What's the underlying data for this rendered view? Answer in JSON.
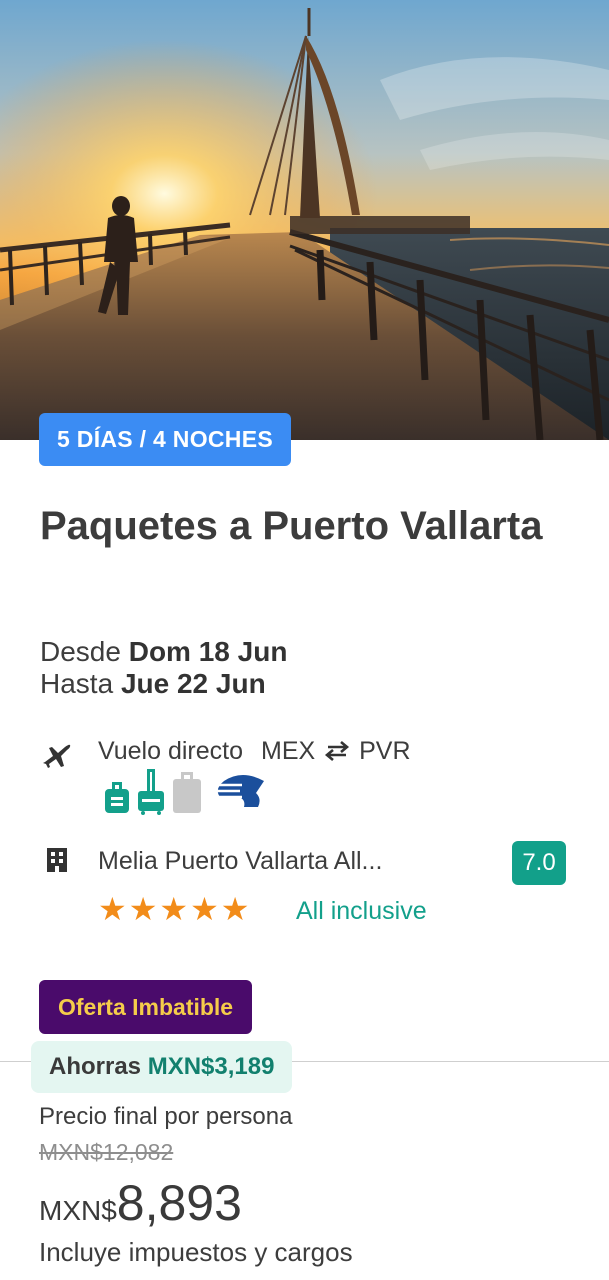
{
  "hero": {
    "image": "sunset-pier-puerto-vallarta"
  },
  "badge": {
    "days_nights": "5 DÍAS / 4 NOCHES"
  },
  "package": {
    "title": "Paquetes a Puerto Vallarta",
    "from_label": "Desde",
    "from_date": "Dom 18 Jun",
    "to_label": "Hasta",
    "to_date": "Jue 22 Jun"
  },
  "flight": {
    "icon": "plane-icon",
    "type": "Vuelo directo",
    "origin": "MEX",
    "destination": "PVR",
    "swap_icon": "swap-arrows-icon",
    "baggage": [
      {
        "icon": "personal-bag-icon",
        "included": true
      },
      {
        "icon": "carry-on-icon",
        "included": true
      },
      {
        "icon": "checked-bag-icon",
        "included": false
      }
    ],
    "airline_logo": "airline-logo",
    "colors": {
      "included": "#13a08b",
      "not_included": "#c8c8c8",
      "airline": "#1b4f9c"
    }
  },
  "hotel": {
    "icon": "building-icon",
    "name": "Melia Puerto Vallarta All...",
    "rating": "7.0",
    "stars": "★★★★★",
    "stars_count": 5,
    "meal_plan": "All inclusive"
  },
  "offer": {
    "label": "Oferta Imbatible"
  },
  "savings": {
    "label": "Ahorras",
    "amount": "MXN$3,189"
  },
  "price": {
    "label": "Precio final por persona",
    "old_price": "MXN$12,082",
    "currency": "MXN$",
    "amount": "8,893",
    "note": "Incluye impuestos y cargos"
  },
  "colors": {
    "badge_blue": "#3b8cf3",
    "offer_purple": "#4a0b6b",
    "offer_text": "#f5cc4a",
    "rating_green": "#12a08a",
    "star_orange": "#f28c1a",
    "savings_bg": "#e4f6f1"
  }
}
